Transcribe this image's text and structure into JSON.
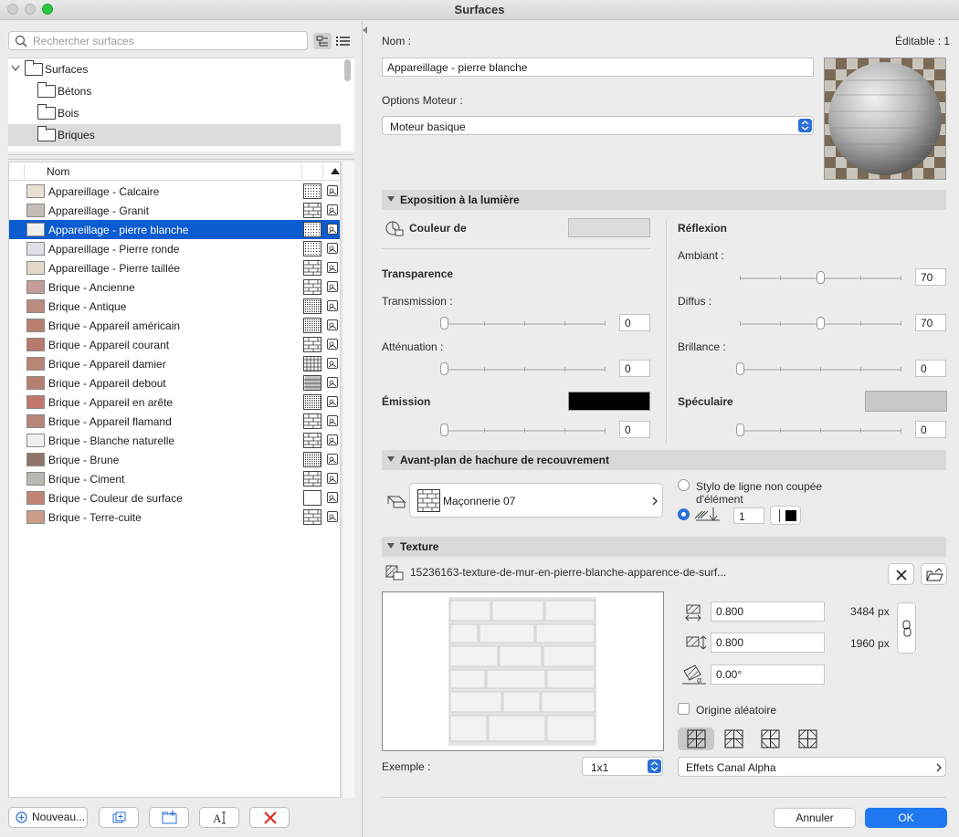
{
  "window": {
    "title": "Surfaces"
  },
  "search": {
    "placeholder": "Rechercher surfaces"
  },
  "tree": {
    "items": [
      {
        "label": "Surfaces"
      },
      {
        "label": "Bétons"
      },
      {
        "label": "Bois"
      },
      {
        "label": "Briques"
      }
    ]
  },
  "list": {
    "column_name": "Nom",
    "items": [
      {
        "label": "Appareillage - Calcaire",
        "color": "#e9e0d4"
      },
      {
        "label": "Appareillage - Granit",
        "color": "#c3bfb8"
      },
      {
        "label": "Appareillage - pierre blanche",
        "color": "#f0f0f0"
      },
      {
        "label": "Appareillage - Pierre ronde",
        "color": "#dde0e6"
      },
      {
        "label": "Appareillage - Pierre taillée",
        "color": "#e4d8c8"
      },
      {
        "label": "Brique - Ancienne",
        "color": "#c29e96"
      },
      {
        "label": "Brique - Antique",
        "color": "#b98c7f"
      },
      {
        "label": "Brique - Appareil américain",
        "color": "#b98070"
      },
      {
        "label": "Brique - Appareil courant",
        "color": "#b8796c"
      },
      {
        "label": "Brique - Appareil damier",
        "color": "#b98574"
      },
      {
        "label": "Brique - Appareil debout",
        "color": "#b47f6f"
      },
      {
        "label": "Brique - Appareil en arête",
        "color": "#c2766c"
      },
      {
        "label": "Brique - Appareil flamand",
        "color": "#b88578"
      },
      {
        "label": "Brique - Blanche naturelle",
        "color": "#efefef"
      },
      {
        "label": "Brique - Brune",
        "color": "#8f7668"
      },
      {
        "label": "Brique - Ciment",
        "color": "#b9b8b2"
      },
      {
        "label": "Brique - Couleur de surface",
        "color": "#c28475"
      },
      {
        "label": "Brique - Terre-cuite",
        "color": "#c89c85"
      }
    ],
    "selected_index": 2
  },
  "bottom_buttons": {
    "new_label": "Nouveau..."
  },
  "detail": {
    "name_label": "Nom :",
    "editable_label": "Éditable : 1",
    "name_value": "Appareillage - pierre blanche",
    "engine_label": "Options Moteur :",
    "engine_value": "Moteur basique"
  },
  "exposure": {
    "header": "Exposition à la lumière",
    "color_label": "Couleur de",
    "transparency_label": "Transparence",
    "transmission_label": "Transmission :",
    "transmission_value": "0",
    "attenuation_label": "Atténuation :",
    "attenuation_value": "0",
    "emission_label": "Émission",
    "emission_value": "0",
    "reflection_label": "Réflexion",
    "ambient_label": "Ambiant :",
    "ambient_value": "70",
    "diffuse_label": "Diffus :",
    "diffuse_value": "70",
    "shine_label": "Brillance :",
    "shine_value": "0",
    "specular_label": "Spéculaire",
    "specular_value": "0",
    "emission_color": "#000000",
    "specular_color": "#c8c8c8"
  },
  "hatch": {
    "header": "Avant-plan de hachure de recouvrement",
    "pattern_name": "Maçonnerie 07",
    "option_uncut": "Stylo de ligne non coupée d'élément",
    "pen_value": "1"
  },
  "texture": {
    "header": "Texture",
    "file_name": "15236163-texture-de-mur-en-pierre-blanche-apparence-de-surf...",
    "width_value": "0.800",
    "width_px": "3484 px",
    "height_value": "0.800",
    "height_px": "1960 px",
    "angle_value": "0.00°",
    "random_origin_label": "Origine aléatoire",
    "example_label": "Exemple :",
    "example_value": "1x1",
    "alpha_label": "Effets Canal Alpha"
  },
  "actions": {
    "cancel_label": "Annuler",
    "ok_label": "OK"
  }
}
